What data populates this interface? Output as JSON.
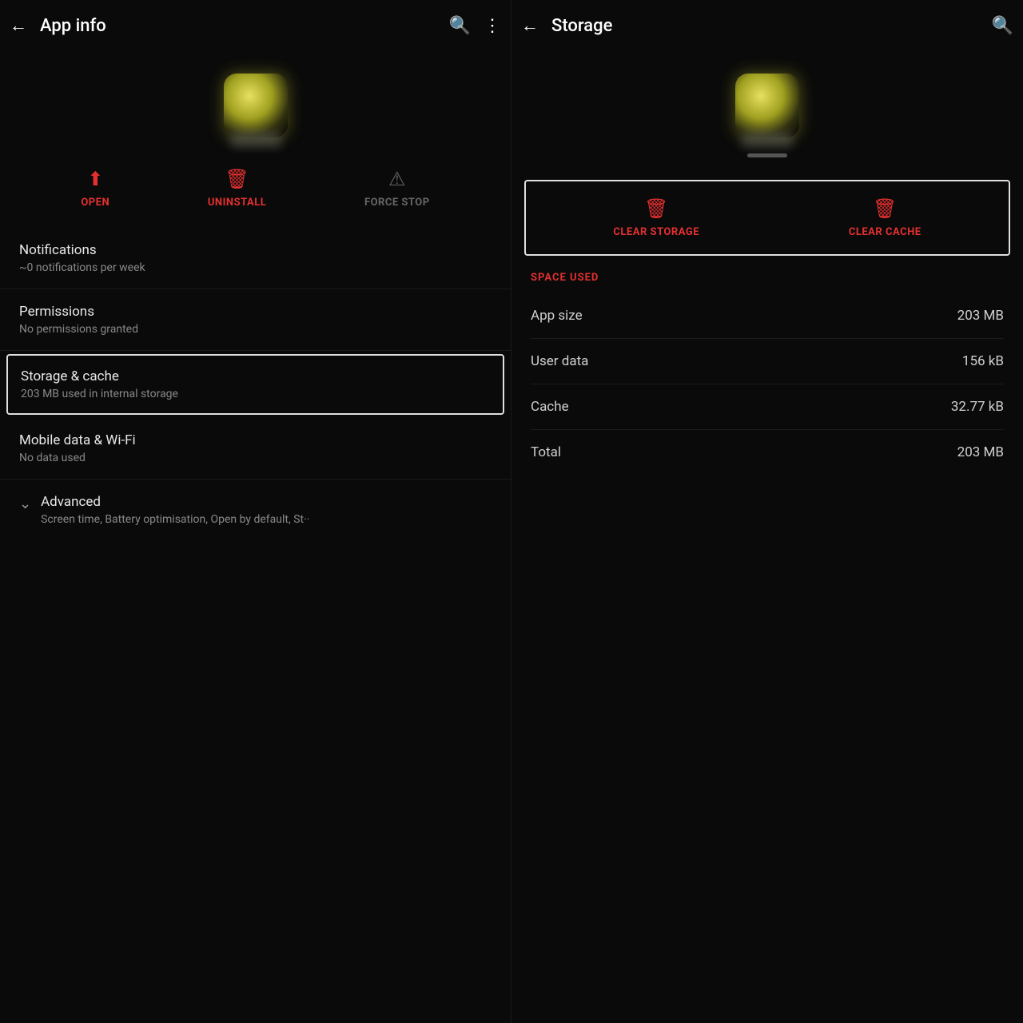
{
  "left": {
    "header": {
      "back_icon": "←",
      "title": "App info",
      "search_icon": "🔍",
      "more_icon": "⋮"
    },
    "actions": [
      {
        "id": "open",
        "icon": "⬆",
        "label": "OPEN",
        "color": "red"
      },
      {
        "id": "uninstall",
        "icon": "🗑",
        "label": "UNINSTALL",
        "color": "red"
      },
      {
        "id": "force_stop",
        "icon": "⚠",
        "label": "FORCE STOP",
        "color": "gray"
      }
    ],
    "menu_items": [
      {
        "id": "notifications",
        "title": "Notifications",
        "sub": "~0 notifications per week",
        "highlighted": false
      },
      {
        "id": "permissions",
        "title": "Permissions",
        "sub": "No permissions granted",
        "highlighted": false
      },
      {
        "id": "storage",
        "title": "Storage & cache",
        "sub": "203 MB used in internal storage",
        "highlighted": true
      },
      {
        "id": "mobile_data",
        "title": "Mobile data & Wi-Fi",
        "sub": "No data used",
        "highlighted": false
      }
    ],
    "advanced": {
      "title": "Advanced",
      "sub": "Screen time, Battery optimisation, Open by default, St··"
    }
  },
  "right": {
    "header": {
      "back_icon": "←",
      "title": "Storage",
      "search_icon": "🔍"
    },
    "clear_buttons": [
      {
        "id": "clear_storage",
        "icon": "🗑",
        "label": "CLEAR STORAGE"
      },
      {
        "id": "clear_cache",
        "icon": "🗑",
        "label": "CLEAR CACHE"
      }
    ],
    "space_used_label": "SPACE USED",
    "space_rows": [
      {
        "id": "app_size",
        "label": "App size",
        "value": "203 MB"
      },
      {
        "id": "user_data",
        "label": "User data",
        "value": "156 kB"
      },
      {
        "id": "cache",
        "label": "Cache",
        "value": "32.77 kB"
      },
      {
        "id": "total",
        "label": "Total",
        "value": "203 MB"
      }
    ]
  }
}
